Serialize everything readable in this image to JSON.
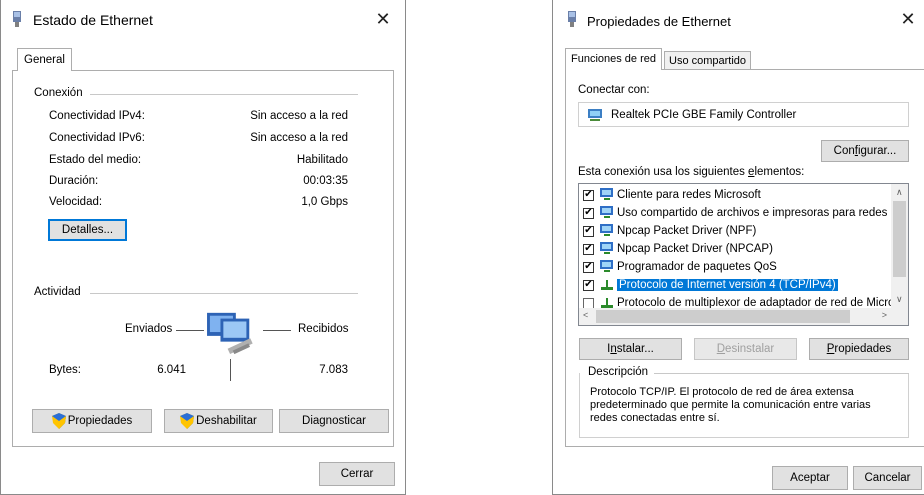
{
  "left_window": {
    "title": "Estado de Ethernet",
    "close": "✕",
    "tab_general": "General",
    "conexion_group": "Conexión",
    "rows": [
      {
        "label": "Conectividad IPv4:",
        "value": "Sin acceso a la red"
      },
      {
        "label": "Conectividad IPv6:",
        "value": "Sin acceso a la red"
      },
      {
        "label": "Estado del medio:",
        "value": "Habilitado"
      },
      {
        "label": "Duración:",
        "value": "00:03:35"
      },
      {
        "label": "Velocidad:",
        "value": "1,0 Gbps"
      }
    ],
    "details_button": "Detalles...",
    "actividad_group": "Actividad",
    "sent_label": "Enviados",
    "received_label": "Recibidos",
    "bytes_label": "Bytes:",
    "bytes_sent": "6.041",
    "bytes_received": "7.083",
    "properties_button": "Propiedades",
    "disable_button": "Deshabilitar",
    "diagnose_button": "Diagnosticar",
    "close_button": "Cerrar"
  },
  "right_window": {
    "title": "Propiedades de Ethernet",
    "close": "✕",
    "tab_network": "Funciones de red",
    "tab_sharing": "Uso compartido",
    "connect_using_label": "Conectar con:",
    "adapter_name": "Realtek PCIe GBE Family Controller",
    "configure_button_pre": "Con",
    "configure_button_u": "f",
    "configure_button_post": "igurar...",
    "elements_label_pre": "Esta conexión usa los siguientes ",
    "elements_label_u": "e",
    "elements_label_post": "lementos:",
    "items": [
      {
        "label": "Cliente para redes Microsoft",
        "checked": true
      },
      {
        "label": "Uso compartido de archivos e impresoras para redes M",
        "checked": true
      },
      {
        "label": "Npcap Packet Driver (NPF)",
        "checked": true
      },
      {
        "label": "Npcap Packet Driver (NPCAP)",
        "checked": true
      },
      {
        "label": "Programador de paquetes QoS",
        "checked": true
      },
      {
        "label": "Protocolo de Internet versión 4 (TCP/IPv4)",
        "checked": true
      },
      {
        "label": "Protocolo de multiplexor de adaptador de red de Micros",
        "checked": false
      }
    ],
    "install_pre": "I",
    "install_u": "n",
    "install_post": "stalar...",
    "uninstall_u": "D",
    "uninstall_post": "esinstalar",
    "properties_u": "P",
    "properties_post": "ropiedades",
    "description_group": "Descripción",
    "description_text": "Protocolo TCP/IP. El protocolo de red de área extensa predeterminado que permite la comunicación entre varias redes conectadas entre sí.",
    "accept_button": "Aceptar",
    "cancel_button": "Cancelar"
  },
  "colors": {
    "accent": "#0078d7",
    "button_bg": "#e1e1e1"
  }
}
